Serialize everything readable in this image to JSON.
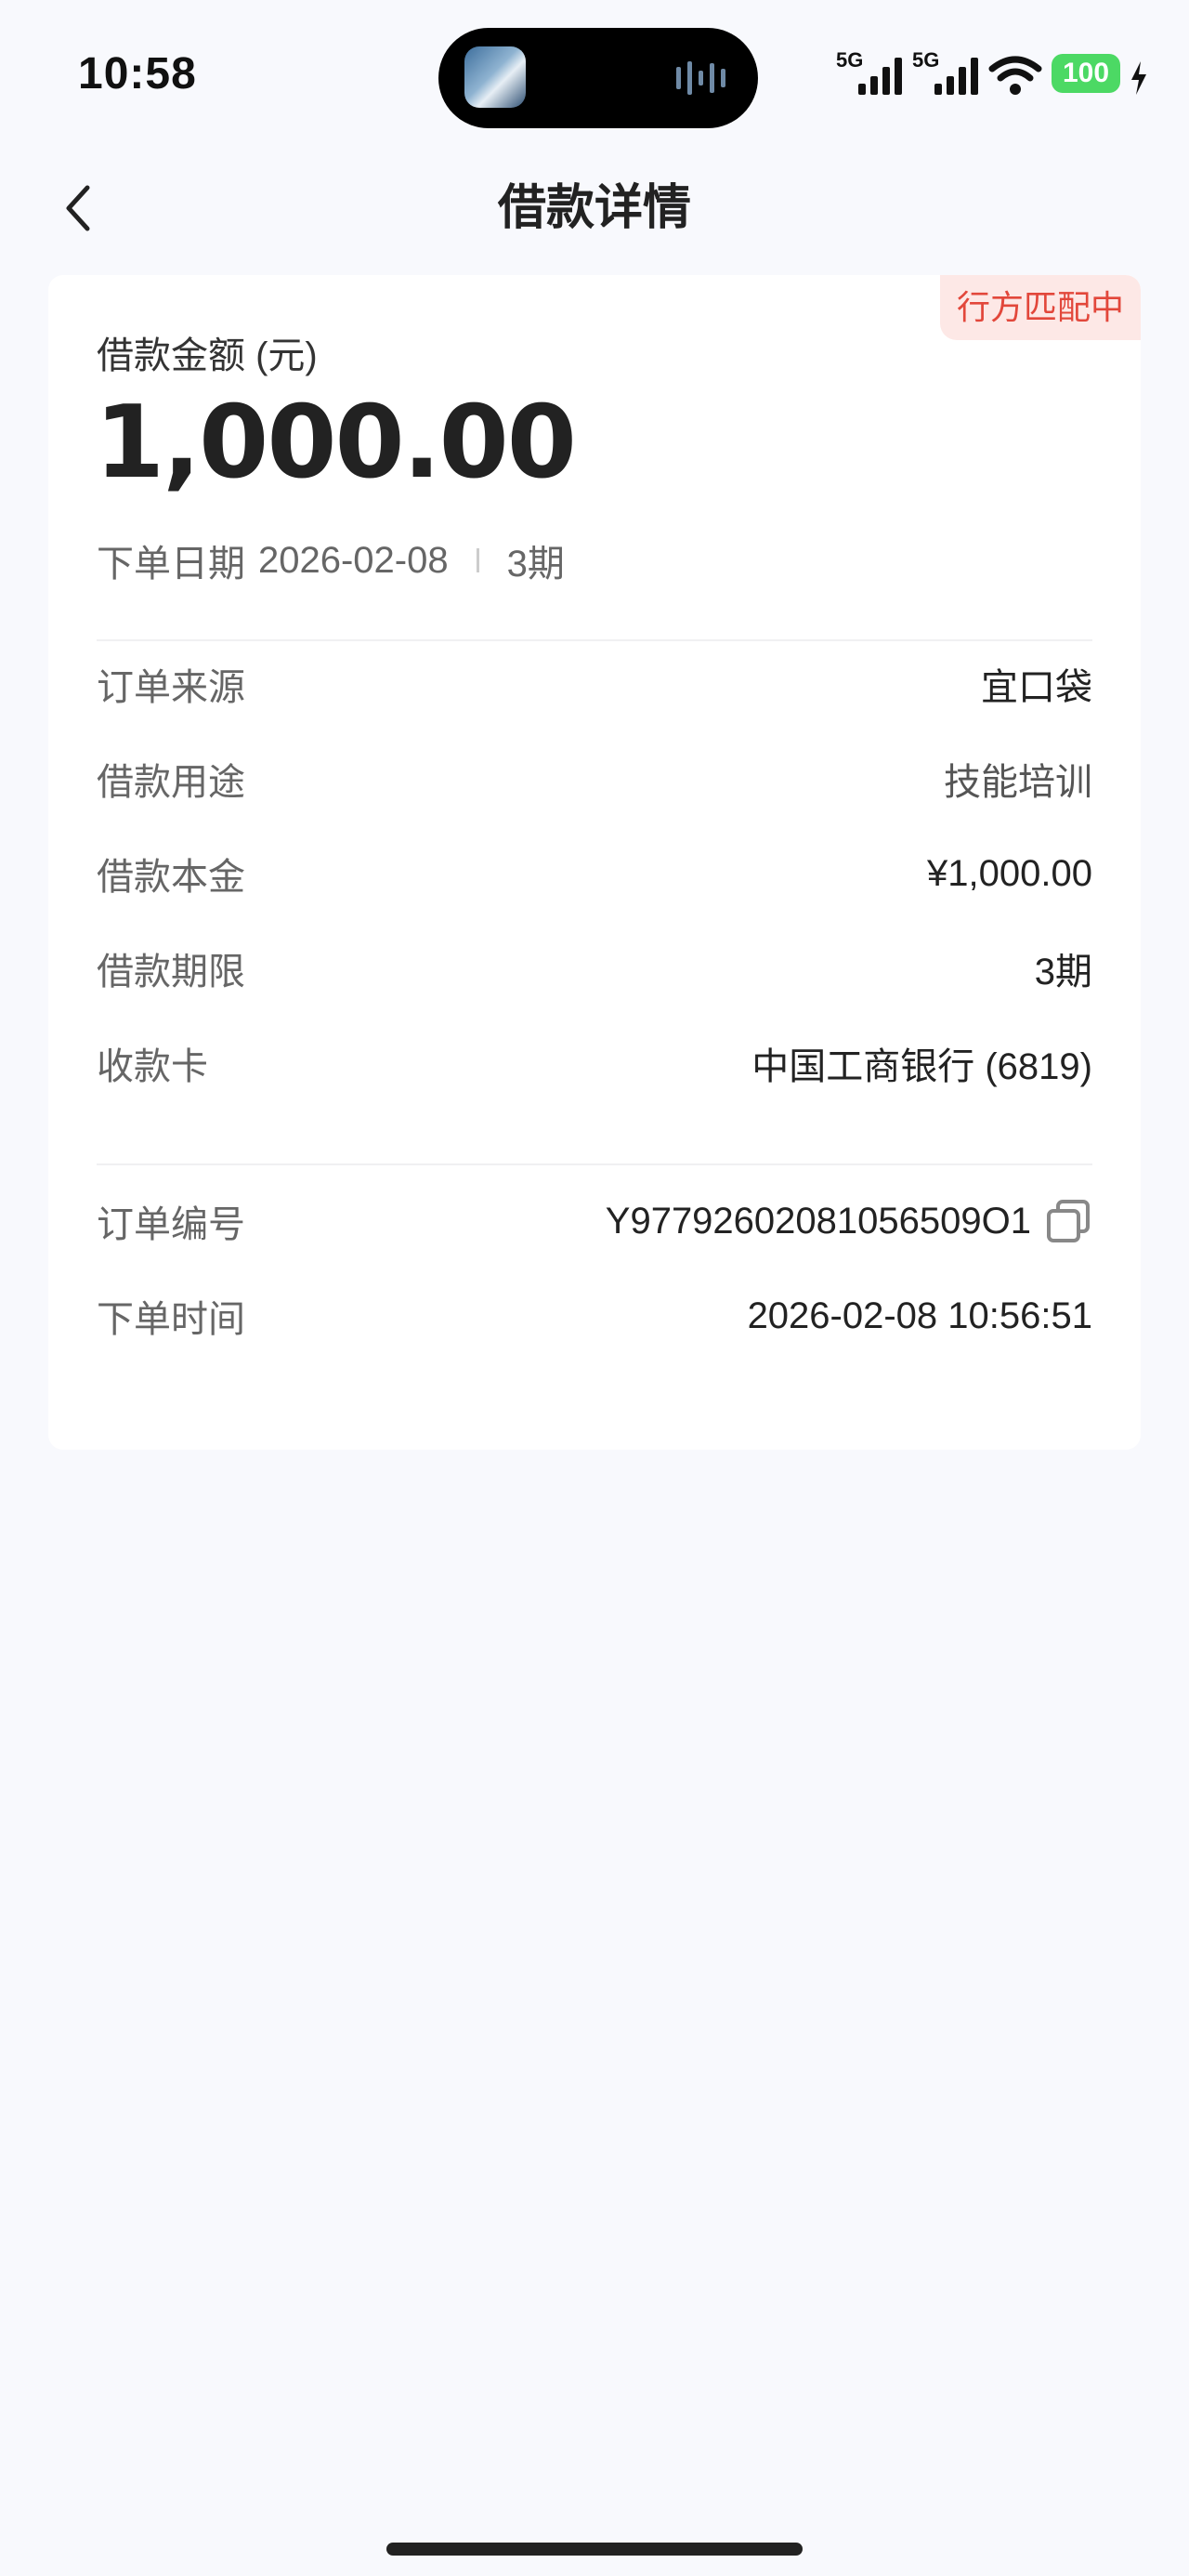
{
  "status_bar": {
    "time": "10:58",
    "signal_1": "5G",
    "signal_2": "5G",
    "battery": "100"
  },
  "header": {
    "title": "借款详情"
  },
  "card": {
    "status_badge": "行方匹配中",
    "amount_label": "借款金额 (元)",
    "amount_value": "1,000.00",
    "order_date_label": "下单日期",
    "order_date": "2026-02-08",
    "term": "3期",
    "details": [
      {
        "label": "订单来源",
        "value": "宜口袋"
      },
      {
        "label": "借款用途",
        "value": "技能培训"
      },
      {
        "label": "借款本金",
        "value": "¥1,000.00"
      },
      {
        "label": "借款期限",
        "value": "3期"
      },
      {
        "label": "收款卡",
        "value": "中国工商银行 (6819)"
      }
    ],
    "order_no_label": "订单编号",
    "order_no": "Y97792602081056509O1",
    "order_time_label": "下单时间",
    "order_time": "2026-02-08 10:56:51"
  },
  "colors": {
    "page_bg": "#f8f9fd",
    "badge_bg": "#fde8e6",
    "badge_text": "#e2473b",
    "battery": "#4cd964"
  },
  "icons": [
    "back-arrow-icon",
    "copy-icon",
    "wifi-icon",
    "signal-icon",
    "charging-icon"
  ]
}
